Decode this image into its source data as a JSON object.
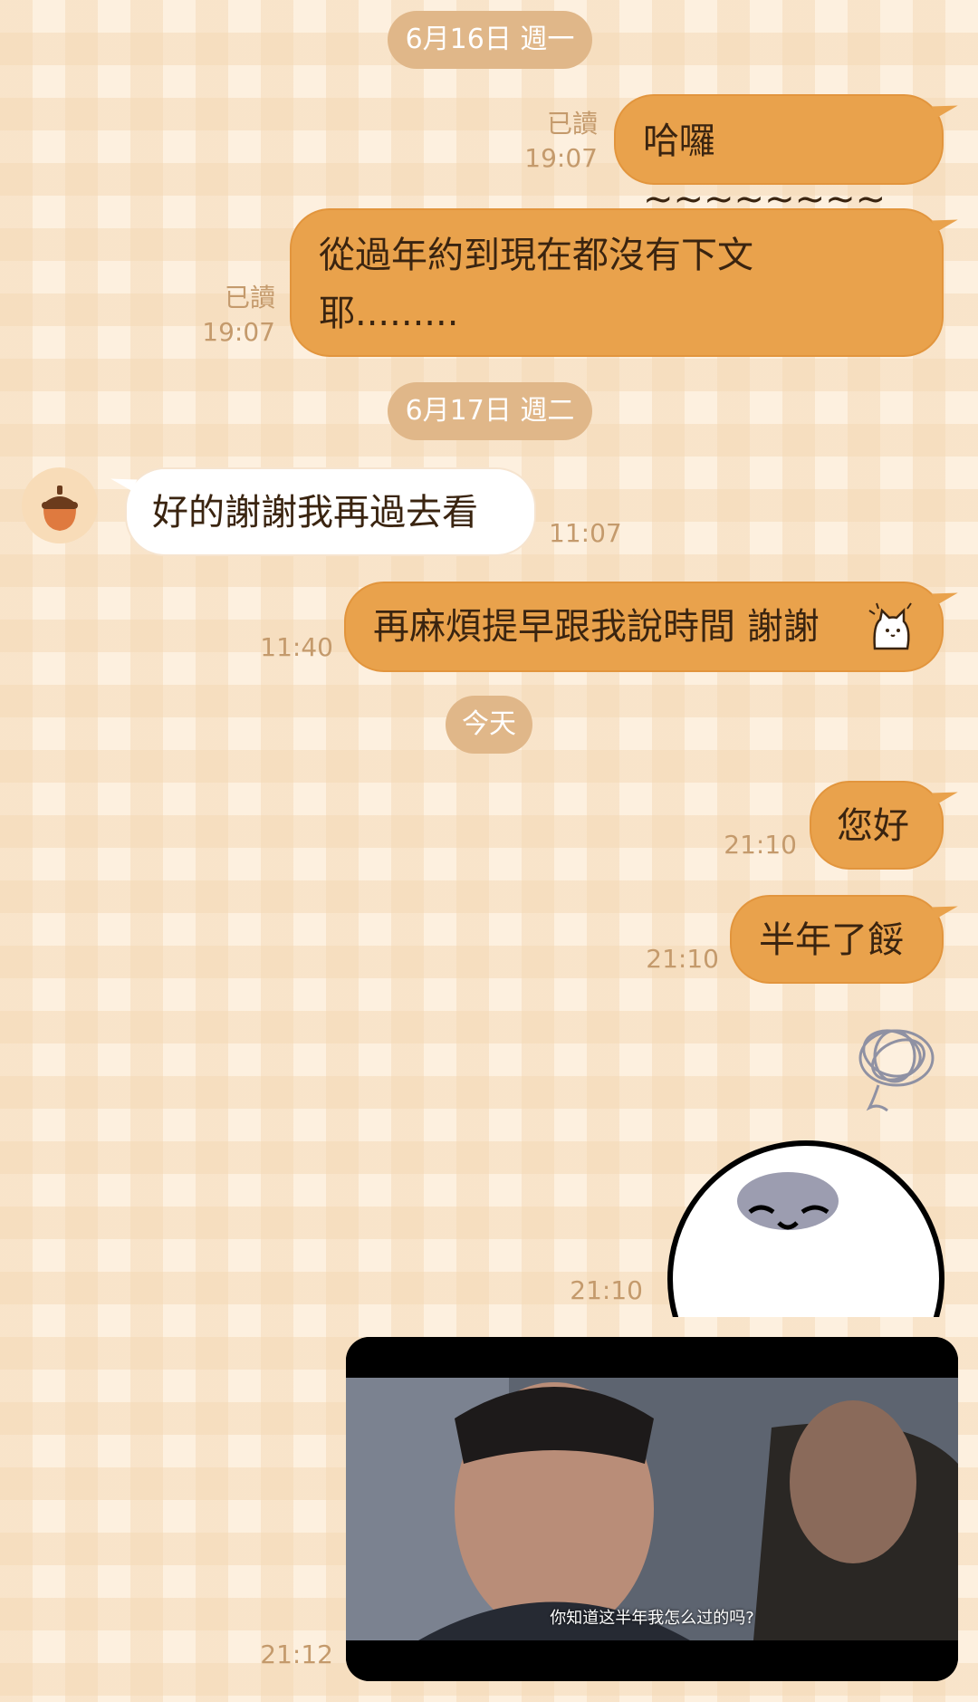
{
  "dates": {
    "d1": "6月16日 週一",
    "d2": "6月17日 週二",
    "d3": "今天"
  },
  "messages": {
    "m1": {
      "text": "哈囉~~~~~~~~",
      "read": "已讀",
      "time": "19:07"
    },
    "m2": {
      "line1": "從過年約到現在都沒有下文",
      "line2": "耶.........",
      "read": "已讀",
      "time": "19:07"
    },
    "m3": {
      "text": "好的謝謝我再過去看",
      "time": "11:07"
    },
    "m4": {
      "text": "再麻煩提早跟我說時間 謝謝",
      "time": "11:40"
    },
    "m5": {
      "text": "您好",
      "time": "21:10"
    },
    "m6": {
      "text": "半年了餒",
      "time": "21:10"
    },
    "m7": {
      "time": "21:10"
    },
    "m8": {
      "caption": "你知道这半年我怎么过的吗?",
      "time": "21:12"
    }
  },
  "icons": {
    "avatar": "acorn-icon",
    "sticker_small": "cat-sticker-icon",
    "sticker_big": "sad-blob-sticker",
    "scribble": "scribble-icon"
  }
}
